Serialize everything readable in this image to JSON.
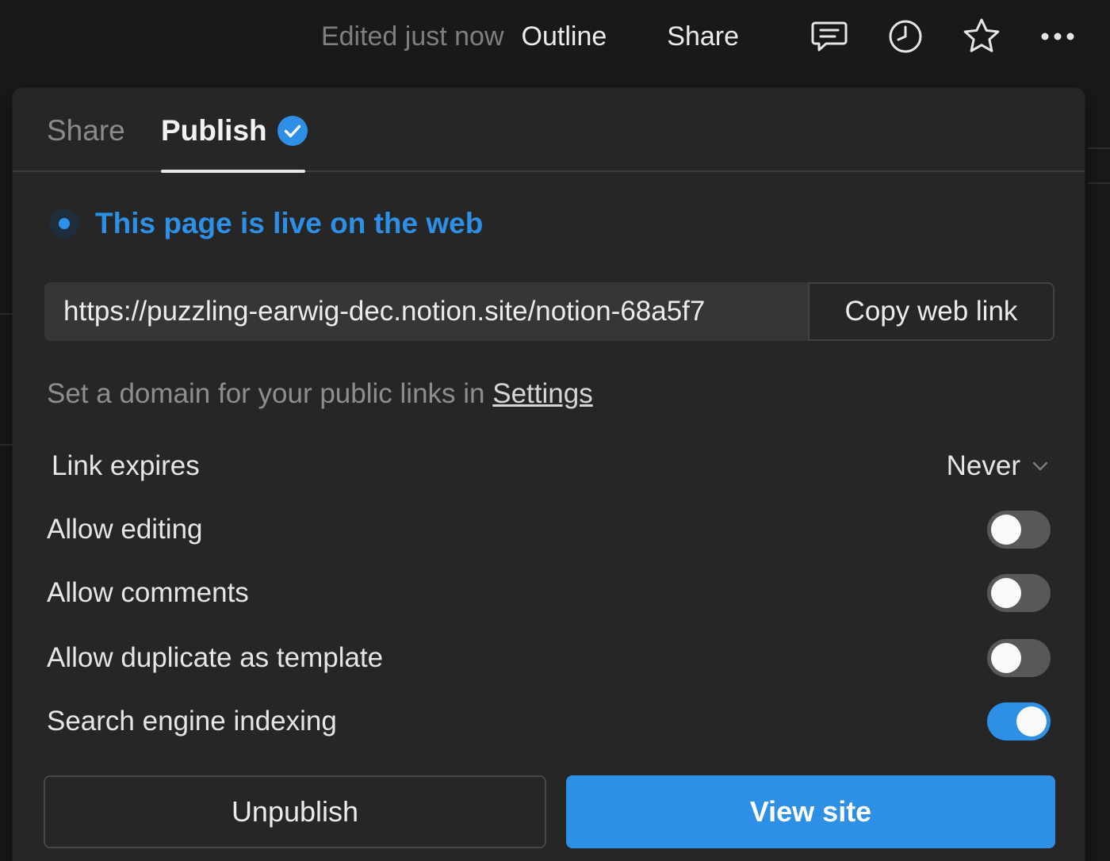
{
  "topbar": {
    "edited_text": "Edited just now",
    "outline_label": "Outline",
    "share_label": "Share",
    "icons": [
      "comment-icon",
      "clock-icon",
      "star-icon",
      "more-icon"
    ]
  },
  "popover": {
    "tabs": [
      {
        "label": "Share",
        "active": false
      },
      {
        "label": "Publish",
        "active": true
      }
    ],
    "status_text": "This page is live on the web",
    "url": "https://puzzling-earwig-dec.notion.site/notion-68a5f7",
    "copy_button_label": "Copy web link",
    "domain_note_prefix": "Set a domain for your public links in",
    "domain_note_link": "Settings",
    "link_expires": {
      "label": "Link expires",
      "value": "Never"
    },
    "options": [
      {
        "label": "Allow editing",
        "enabled": false
      },
      {
        "label": "Allow comments",
        "enabled": false
      },
      {
        "label": "Allow duplicate as template",
        "enabled": false
      },
      {
        "label": "Search engine indexing",
        "enabled": true
      }
    ],
    "unpublish_label": "Unpublish",
    "view_site_label": "View site"
  },
  "colors": {
    "accent": "#2e8fe6",
    "background": "#191919",
    "panel": "#262626"
  }
}
